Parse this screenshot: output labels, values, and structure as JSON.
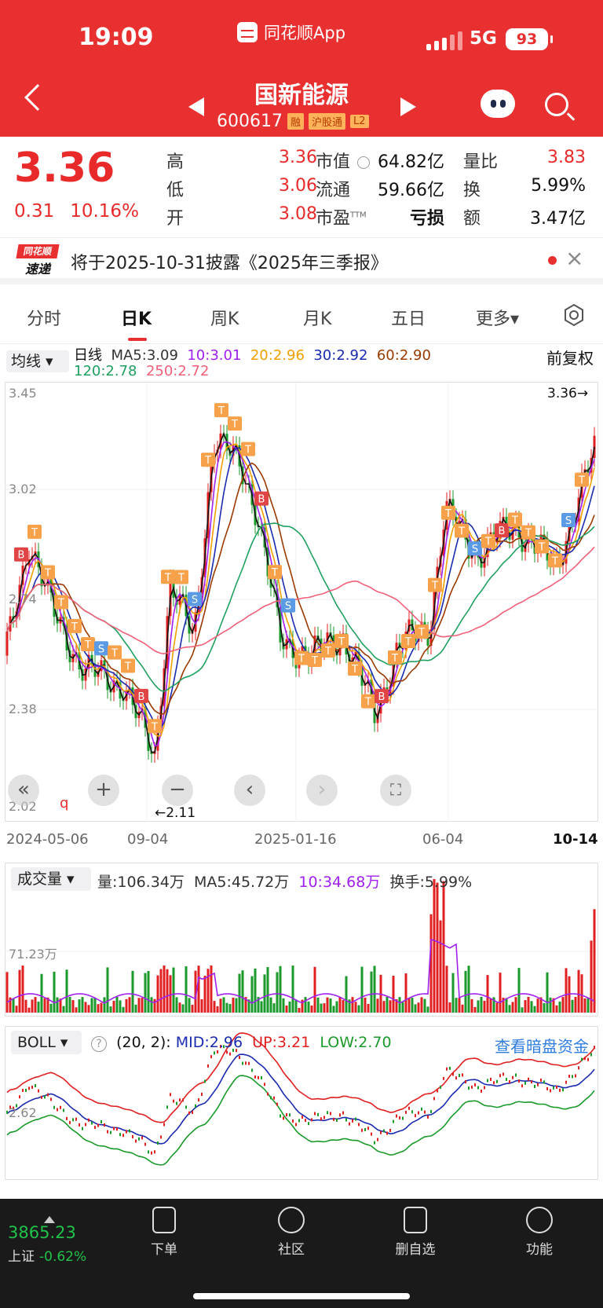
{
  "status_bar": {
    "time": "19:09",
    "app_name": "同花顺App",
    "network": "5G",
    "battery": "93"
  },
  "header": {
    "title": "国新能源",
    "code": "600617",
    "tags": [
      "融",
      "沪股通",
      "L2"
    ]
  },
  "quote": {
    "price": "3.36",
    "change": "0.31",
    "change_pct": "10.16%",
    "high_label": "高",
    "high": "3.36",
    "low_label": "低",
    "low": "3.06",
    "open_label": "开",
    "open": "3.08",
    "mktcap_label": "市值",
    "mktcap": "64.82亿",
    "float_label": "流通",
    "float": "59.66亿",
    "pe_label": "市盈",
    "pe_sup": "TTM",
    "pe": "亏损",
    "vol_ratio_label": "量比",
    "vol_ratio": "3.83",
    "turnover_label": "换",
    "turnover": "5.99%",
    "amount_label": "额",
    "amount": "3.47亿"
  },
  "notice": {
    "logo_top": "同花顺",
    "logo_bottom": "速递",
    "text": "将于2025-10-31披露《2025年三季报》"
  },
  "tabs": [
    "分时",
    "日K",
    "周K",
    "月K",
    "五日",
    "更多▾"
  ],
  "kline": {
    "ma_selector": "均线 ▾",
    "ma_title": "日线",
    "ma5": "MA5:3.09",
    "ma10": "10:3.01",
    "ma20": "20:2.96",
    "ma30": "30:2.92",
    "ma60": "60:2.90",
    "ma120": "120:2.78",
    "ma250": "250:2.72",
    "adjust": "前复权",
    "y_ticks": [
      "3.45",
      "3.02",
      "2.74",
      "2.38",
      "2.02"
    ],
    "last_price": "3.36→",
    "low_mark": "←2.11",
    "dates": [
      "2024-05-06",
      "09-04",
      "2025-01-16",
      "06-04",
      "10-14"
    ],
    "colors": {
      "ma5": "#111111",
      "ma10": "#a020f0",
      "ma20": "#f0a000",
      "ma30": "#1a2bb0",
      "ma60": "#9a3a00",
      "ma120": "#20a060",
      "ma250": "#f06078",
      "up": "#e02020",
      "down": "#1a9a2a",
      "t_tag": "#f7a24a",
      "s_tag": "#5b9be6",
      "b_tag": "#e04444"
    }
  },
  "volume": {
    "selector": "成交量 ▾",
    "vol": "量:106.34万",
    "ma5": "MA5:45.72万",
    "ma10": "10:34.68万",
    "turnover": "换手:5.99%",
    "y_tick": "71.23万"
  },
  "boll": {
    "selector": "BOLL ▾",
    "help_icon": "?",
    "params": "(20, 2):",
    "mid": "MID:2.96",
    "up": "UP:3.21",
    "low": "LOW:2.70",
    "y_tick": "2.62",
    "link": "查看暗盘资金"
  },
  "bottom_nav": {
    "index_value": "3865.23",
    "index_name": "上证",
    "index_change": "-0.62%",
    "items": [
      "下单",
      "社区",
      "删自选",
      "功能"
    ]
  }
}
